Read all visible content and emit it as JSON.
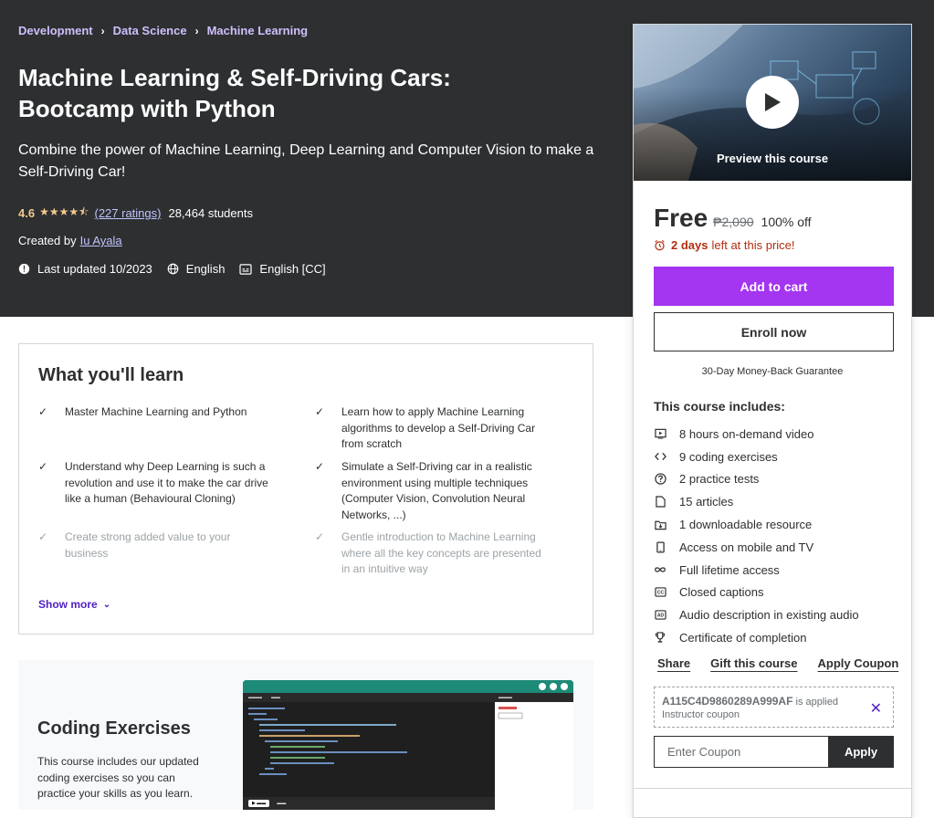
{
  "breadcrumbs": [
    "Development",
    "Data Science",
    "Machine Learning"
  ],
  "course": {
    "title": "Machine Learning & Self-Driving Cars: Bootcamp with Python",
    "subtitle": "Combine the power of Machine Learning, Deep Learning and Computer Vision to make a Self-Driving Car!",
    "rating": "4.6",
    "stars": "★★★★⯪",
    "ratings_count": "(227 ratings)",
    "students": "28,464 students",
    "created_by_label": "Created by",
    "instructor": "Iu Ayala",
    "last_updated": "Last updated 10/2023",
    "language": "English",
    "captions": "English [CC]"
  },
  "sidebar": {
    "preview_label": "Preview this course",
    "price": "Free",
    "original_price": "₱2,090",
    "discount": "100% off",
    "timer_bold": "2 days",
    "timer_rest": "left at this price!",
    "add_to_cart": "Add to cart",
    "enroll_now": "Enroll now",
    "guarantee": "30-Day Money-Back Guarantee",
    "includes_title": "This course includes:",
    "includes": [
      {
        "icon": "video-icon",
        "text": "8 hours on-demand video"
      },
      {
        "icon": "code-icon",
        "text": "9 coding exercises"
      },
      {
        "icon": "question-icon",
        "text": "2 practice tests"
      },
      {
        "icon": "file-icon",
        "text": "15 articles"
      },
      {
        "icon": "download-icon",
        "text": "1 downloadable resource"
      },
      {
        "icon": "mobile-icon",
        "text": "Access on mobile and TV"
      },
      {
        "icon": "infinity-icon",
        "text": "Full lifetime access"
      },
      {
        "icon": "cc-icon",
        "text": "Closed captions"
      },
      {
        "icon": "audio-description-icon",
        "text": "Audio description in existing audio"
      },
      {
        "icon": "trophy-icon",
        "text": "Certificate of completion"
      }
    ],
    "share": "Share",
    "gift": "Gift this course",
    "apply_coupon": "Apply Coupon",
    "coupon_code": "A115C4D9860289A999AF",
    "coupon_applied": "is applied",
    "coupon_type": "Instructor coupon",
    "coupon_placeholder": "Enter Coupon",
    "coupon_apply_btn": "Apply"
  },
  "learn": {
    "title": "What you'll learn",
    "items": [
      "Master Machine Learning and Python",
      "Learn how to apply Machine Learning algorithms to develop a Self-Driving Car from scratch",
      "Understand why Deep Learning is such a revolution and use it to make the car drive like a human (Behavioural Cloning)",
      "Simulate a Self-Driving car in a realistic environment using multiple techniques (Computer Vision, Convolution Neural Networks, ...)",
      "Create strong added value to your business",
      "Gentle introduction to Machine Learning where all the key concepts are presented in an intuitive way"
    ],
    "show_more": "Show more"
  },
  "coding": {
    "title": "Coding Exercises",
    "text": "This course includes our updated coding exercises so you can practice your skills as you learn."
  },
  "colors": {
    "hero_bg": "#2d2f31",
    "accent_purple": "#a435f0",
    "link_purple": "#5022c3",
    "star_gold": "#f3ca8c",
    "timer_red": "#b32d0f"
  }
}
